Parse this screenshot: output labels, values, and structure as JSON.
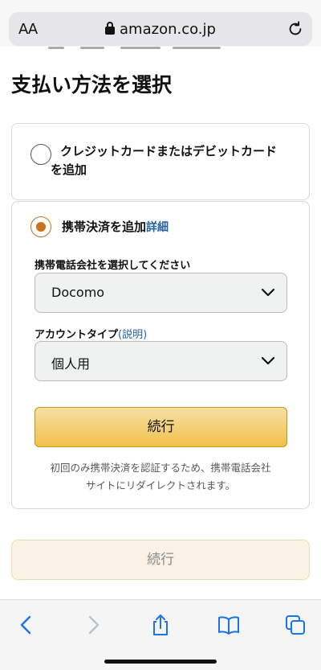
{
  "browser": {
    "text_size_label": "AA",
    "url": "amazon.co.jp"
  },
  "page": {
    "title": "支払い方法を選択"
  },
  "payment_options": {
    "credit": {
      "label_line1": "クレジットカードまたはデビットカード",
      "label_line2": "を追加"
    },
    "mobile": {
      "label": "携帯決済を追加",
      "details_link": "詳細",
      "carrier_label": "携帯電話会社を選択してください",
      "carrier_value": "Docomo",
      "account_type_label": "アカウントタイプ",
      "account_type_link": "(説明)",
      "account_type_value": "個人用",
      "continue_label": "続行",
      "note_line1": "初回のみ携帯決済を認証するため、携帯電話会社",
      "note_line2": "サイトにリダイレクトされます。"
    }
  },
  "footer": {
    "continue_label": "続行"
  },
  "colors": {
    "accent_radio": "#c9731e",
    "link": "#2162a1",
    "primary_button": "#f0c14b",
    "toolbar_icon": "#1a73e8"
  },
  "icons": [
    "lock-icon",
    "reload-icon",
    "chevron-down-icon",
    "back-icon",
    "forward-icon",
    "share-icon",
    "bookmarks-icon",
    "tabs-icon"
  ]
}
